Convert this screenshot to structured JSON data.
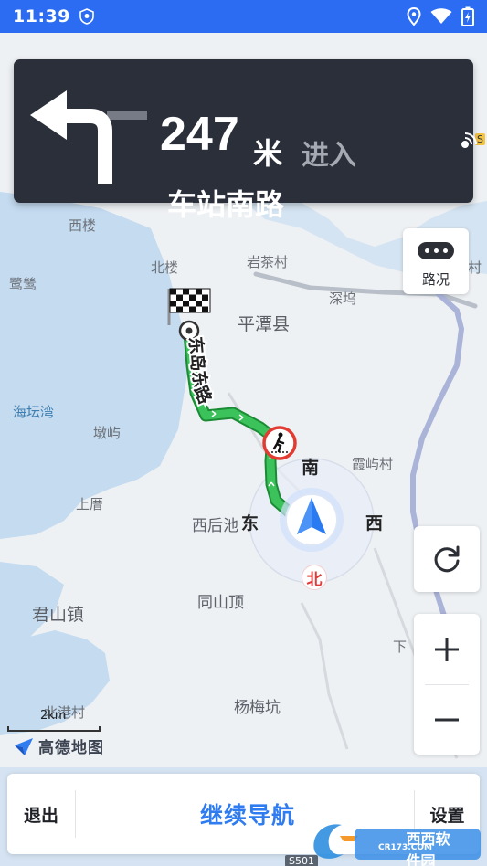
{
  "status_bar": {
    "time": "11:39",
    "icons": [
      "shield-icon",
      "location-icon",
      "wifi-icon",
      "battery-charging-icon"
    ],
    "color": "#2b6cf2"
  },
  "guidance": {
    "distance": "247",
    "unit": "米",
    "action": "进入",
    "road": "车站南路",
    "turn_icon": "turn-left-arrow-icon",
    "voice_icon": "voice-broadcast-icon"
  },
  "map": {
    "places": {
      "xilou": "西楼",
      "beilou": "北楼",
      "yanchacun": "岩茶村",
      "luolu": "鹭鸶",
      "pingtanxian": "平潭县",
      "shenwu": "深坞",
      "haitanwan": "海坛湾",
      "aoyu": "墩屿",
      "xiayucun": "霞屿村",
      "shangcuo": "上厝",
      "xihouchi": "西后池",
      "junshanzhen": "君山镇",
      "tongshanding": "同山顶",
      "beigangcun": "北港村",
      "yangmeikeng": "杨梅坑",
      "xia": "下",
      "cun_edge": "村"
    },
    "route_road": "东岛东路",
    "route_color": "#2fb14a",
    "destination_icon": "checkered-flag-icon",
    "pedestrian_crossing_icon": "pedestrian-crossing-icon",
    "road_badge_s": "S",
    "road_badge_s501": "S501"
  },
  "compass": {
    "south": "南",
    "east": "东",
    "west": "西",
    "north": "北"
  },
  "buttons": {
    "traffic_label": "路况",
    "exit_label": "退出",
    "continue_label": "继续导航",
    "settings_label": "设置"
  },
  "scale": {
    "label": "2km"
  },
  "logo": {
    "text": "高德地图"
  },
  "watermark": {
    "text": "西西软件园",
    "site": "CR173.COM"
  }
}
